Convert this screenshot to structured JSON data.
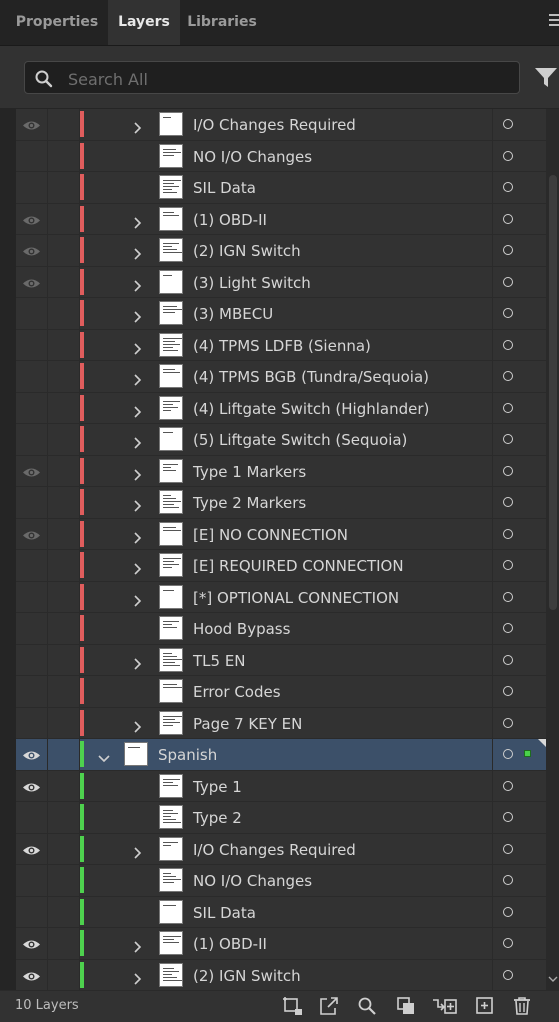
{
  "tabs": [
    {
      "label": "Properties",
      "active": false
    },
    {
      "label": "Layers",
      "active": true
    },
    {
      "label": "Libraries",
      "active": false
    }
  ],
  "search": {
    "placeholder": "Search All",
    "value": ""
  },
  "colors": {
    "red_layer": "#e05d5d",
    "green_layer": "#4ed14e",
    "selected_row": "#3c5069"
  },
  "layers": [
    {
      "name": "I/O Changes Required",
      "visible": true,
      "expandable": true,
      "color": "red"
    },
    {
      "name": "NO I/O Changes",
      "visible": false,
      "expandable": false,
      "color": "red"
    },
    {
      "name": "SIL Data",
      "visible": false,
      "expandable": false,
      "color": "red"
    },
    {
      "name": "(1) OBD-II",
      "visible": true,
      "expandable": true,
      "color": "red"
    },
    {
      "name": "(2) IGN Switch",
      "visible": true,
      "expandable": true,
      "color": "red"
    },
    {
      "name": "(3) Light Switch",
      "visible": true,
      "expandable": true,
      "color": "red"
    },
    {
      "name": "(3) MBECU",
      "visible": false,
      "expandable": true,
      "color": "red"
    },
    {
      "name": "(4) TPMS LDFB (Sienna)",
      "visible": false,
      "expandable": true,
      "color": "red"
    },
    {
      "name": "(4) TPMS BGB (Tundra/Sequoia)",
      "visible": false,
      "expandable": true,
      "color": "red"
    },
    {
      "name": "(4) Liftgate Switch (Highlander)",
      "visible": false,
      "expandable": true,
      "color": "red"
    },
    {
      "name": "(5) Liftgate Switch (Sequoia)",
      "visible": false,
      "expandable": true,
      "color": "red"
    },
    {
      "name": "Type 1 Markers",
      "visible": true,
      "expandable": true,
      "color": "red"
    },
    {
      "name": "Type 2 Markers",
      "visible": false,
      "expandable": true,
      "color": "red"
    },
    {
      "name": "[E] NO CONNECTION",
      "visible": true,
      "expandable": true,
      "color": "red"
    },
    {
      "name": "[E] REQUIRED CONNECTION",
      "visible": false,
      "expandable": true,
      "color": "red"
    },
    {
      "name": "[*] OPTIONAL CONNECTION",
      "visible": false,
      "expandable": true,
      "color": "red"
    },
    {
      "name": "Hood Bypass",
      "visible": false,
      "expandable": false,
      "color": "red"
    },
    {
      "name": "TL5 EN",
      "visible": false,
      "expandable": true,
      "color": "red"
    },
    {
      "name": "Error Codes",
      "visible": false,
      "expandable": false,
      "color": "red"
    },
    {
      "name": "Page 7 KEY EN",
      "visible": false,
      "expandable": true,
      "color": "red"
    },
    {
      "name": "Spanish",
      "visible": true,
      "expandable": true,
      "expanded": true,
      "top_level": true,
      "selected": true,
      "color": "green"
    },
    {
      "name": "Type 1",
      "visible": true,
      "expandable": false,
      "color": "green"
    },
    {
      "name": "Type 2",
      "visible": false,
      "expandable": false,
      "color": "green"
    },
    {
      "name": "I/O Changes Required",
      "visible": true,
      "expandable": true,
      "color": "green"
    },
    {
      "name": "NO I/O Changes",
      "visible": false,
      "expandable": false,
      "color": "green"
    },
    {
      "name": "SIL Data",
      "visible": false,
      "expandable": false,
      "color": "green"
    },
    {
      "name": "(1) OBD-II",
      "visible": true,
      "expandable": true,
      "color": "green"
    },
    {
      "name": "(2) IGN Switch",
      "visible": true,
      "expandable": true,
      "color": "green"
    }
  ],
  "footer": {
    "layer_count": "10 Layers",
    "icons": [
      "collect-for-export-icon",
      "export-icon",
      "locate-object-icon",
      "make-clipping-mask-icon",
      "create-sublayer-icon",
      "create-new-layer-icon",
      "delete-icon"
    ]
  }
}
